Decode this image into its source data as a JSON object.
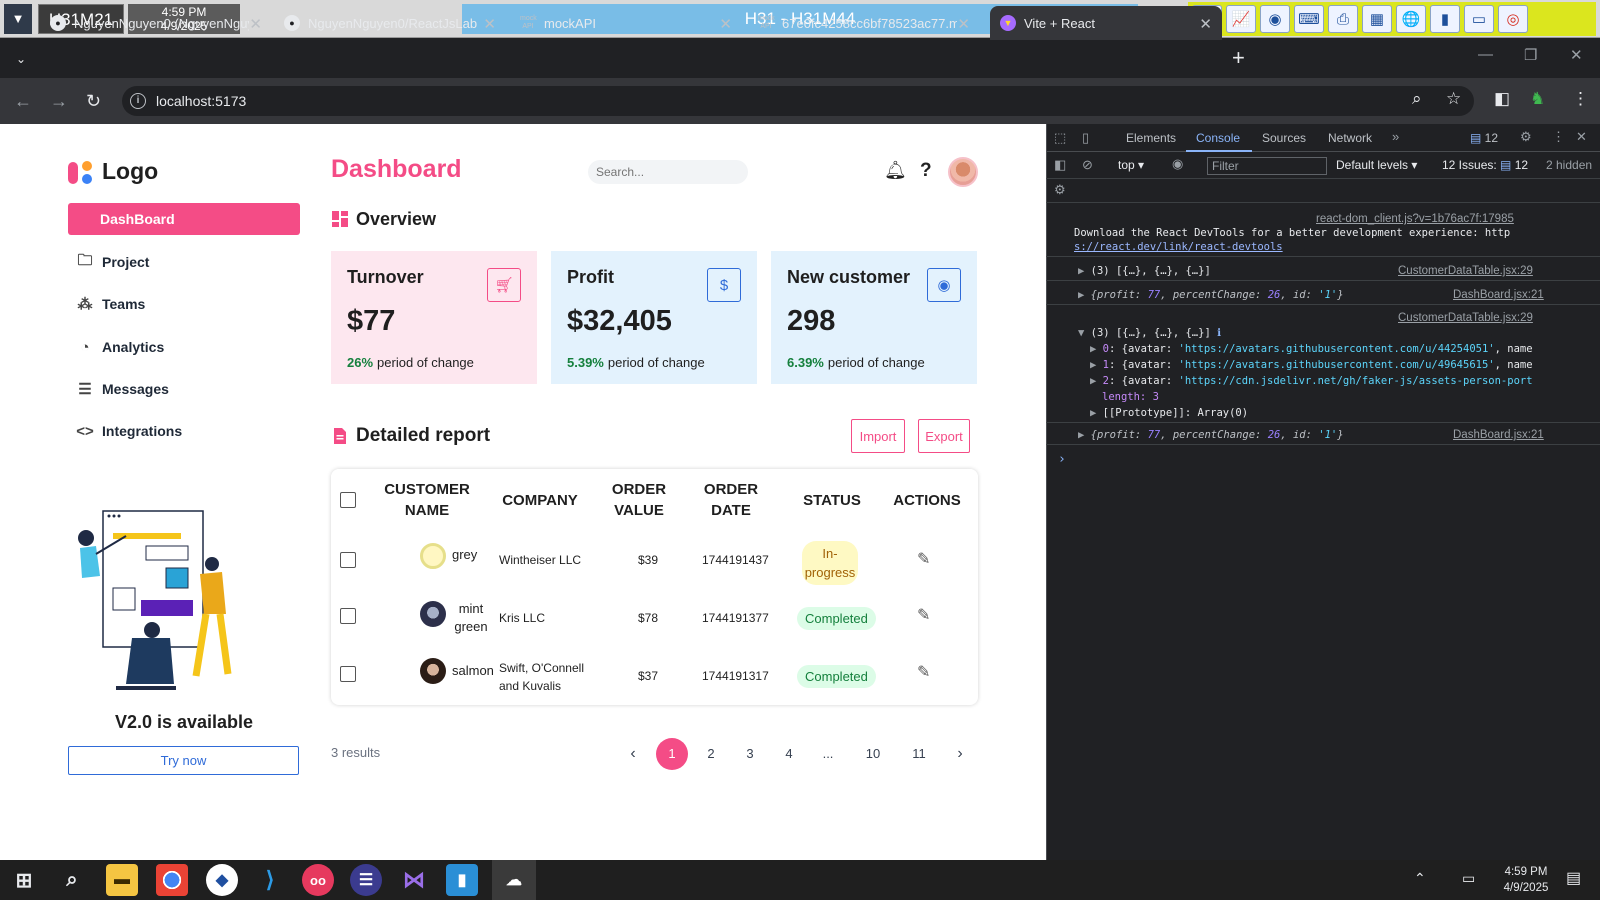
{
  "remote": {
    "host": "H31M21",
    "time": "4:59 PM",
    "date": "4/9/2025",
    "title": "H31 - H31M44"
  },
  "browser": {
    "tabs": [
      {
        "label": "NguyenNguyen0 (NguyenNguy",
        "icon": "github-icon"
      },
      {
        "label": "NguyenNguyen0/ReactJsLab",
        "icon": "github-icon"
      },
      {
        "label": "mockAPI",
        "icon": "mockapi-icon"
      },
      {
        "label": "67e0fc4258cc6bf78523ac77.m",
        "icon": "mockapi-icon"
      },
      {
        "label": "Vite + React",
        "icon": "vite-icon"
      }
    ],
    "url": "localhost:5173"
  },
  "sidebar": {
    "logo": "Logo",
    "items": [
      {
        "label": "DashBoard",
        "icon": "grid-icon"
      },
      {
        "label": "Project",
        "icon": "folder-icon"
      },
      {
        "label": "Teams",
        "icon": "users-icon"
      },
      {
        "label": "Analytics",
        "icon": "chart-pie-icon"
      },
      {
        "label": "Messages",
        "icon": "message-icon"
      },
      {
        "label": "Integrations",
        "icon": "code-icon"
      }
    ],
    "promo_title": "V2.0 is available",
    "promo_button": "Try now"
  },
  "header": {
    "title": "Dashboard",
    "search_placeholder": "Search..."
  },
  "overview": {
    "title": "Overview",
    "cards": [
      {
        "title": "Turnover",
        "value": "$77",
        "change": "26%",
        "change_label": "period of change",
        "icon": "cart-icon",
        "bg": "#fde7ef",
        "accent": "#f44c86"
      },
      {
        "title": "Profit",
        "value": "$32,405",
        "change": "5.39%",
        "change_label": "period of change",
        "icon": "dollar-icon",
        "bg": "#e3f2fd",
        "accent": "#2f6bd8"
      },
      {
        "title": "New customer",
        "value": "298",
        "change": "6.39%",
        "change_label": "period of change",
        "icon": "user-circle-icon",
        "bg": "#e3f2fd",
        "accent": "#2f6bd8"
      }
    ]
  },
  "report": {
    "title": "Detailed report",
    "import": "Import",
    "export": "Export",
    "columns": [
      "CUSTOMER NAME",
      "COMPANY",
      "ORDER VALUE",
      "ORDER DATE",
      "STATUS",
      "ACTIONS"
    ],
    "rows": [
      {
        "name": "grey",
        "company": "Wintheiser LLC",
        "value": "$39",
        "date": "1744191437",
        "status": "In-progress"
      },
      {
        "name": "mint green",
        "company": "Kris LLC",
        "value": "$78",
        "date": "1744191377",
        "status": "Completed"
      },
      {
        "name": "salmon",
        "company": "Swift, O'Connell and Kuvalis",
        "value": "$37",
        "date": "1744191317",
        "status": "Completed"
      }
    ],
    "results": "3 results",
    "pages": [
      "1",
      "2",
      "3",
      "4",
      "...",
      "10",
      "11"
    ],
    "current_page": "1"
  },
  "devtools": {
    "tabs": [
      "Elements",
      "Console",
      "Sources",
      "Network"
    ],
    "badge_count": "12",
    "context": "top",
    "filter_placeholder": "Filter",
    "levels": "Default levels",
    "issues": "12 Issues:",
    "issues_count": "12",
    "hidden": "2 hidden",
    "src1": "react-dom_client.js?v=1b76ac7f:17985",
    "msg1a": "Download the React DevTools for a better development experience: http",
    "msg1b": "s://react.dev/link/react-devtools",
    "log1": "(3) [{…}, {…}, {…}]",
    "src_table": "CustomerDataTable.jsx:29",
    "src_dash": "DashBoard.jsx:21",
    "log4_len": "length: 3",
    "log4_proto": "[[Prototype]]: Array(0)"
  },
  "taskbar": {
    "time": "4:59 PM",
    "date": "4/9/2025"
  }
}
